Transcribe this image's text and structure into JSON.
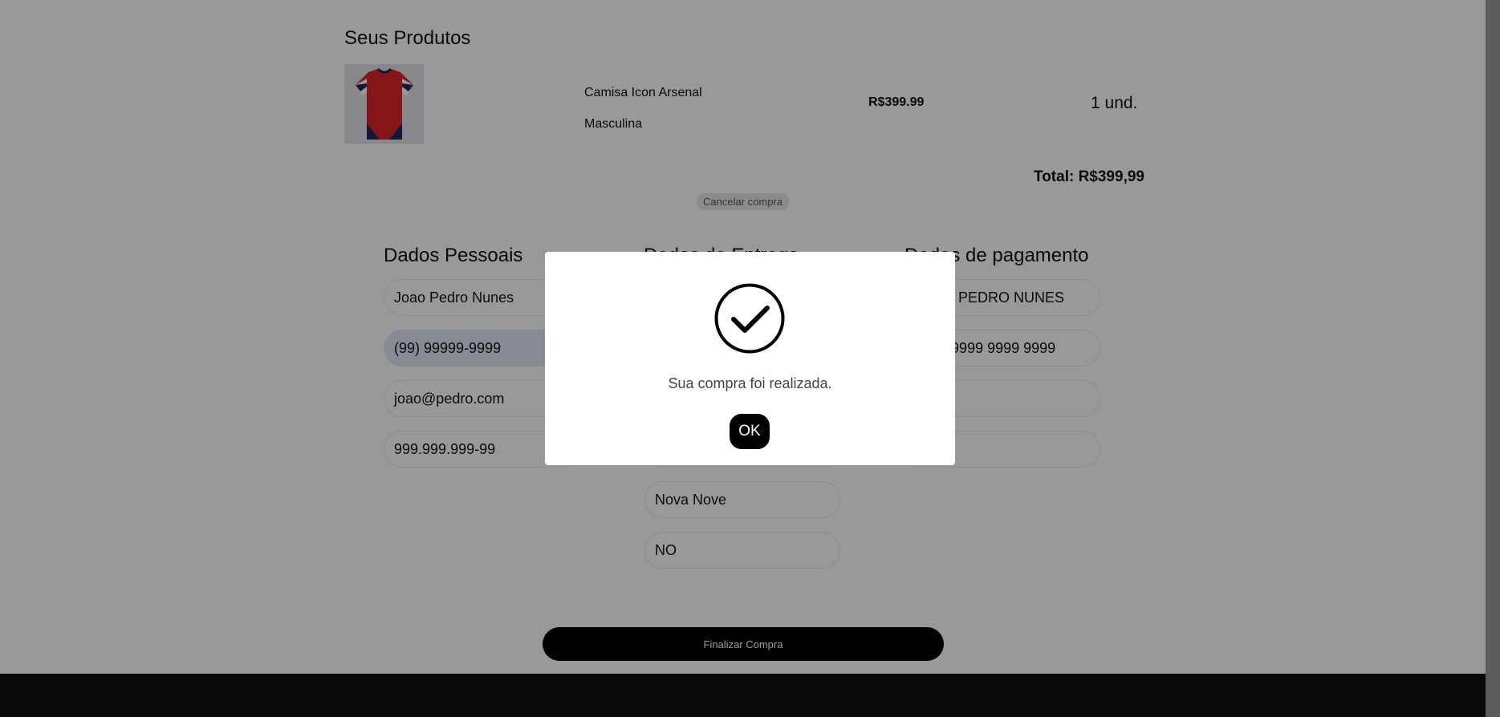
{
  "products": {
    "title": "Seus Produtos",
    "items": [
      {
        "name": "Camisa Icon Arsenal Masculina",
        "price": "R$399.99",
        "quantity": "1 und.",
        "image": "red-jersey-icon"
      }
    ],
    "total": "Total: R$399,99",
    "cancel_label": "Cancelar compra"
  },
  "personal": {
    "title": "Dados Pessoais",
    "name": "Joao Pedro Nunes",
    "phone": "(99) 99999-9999",
    "email": "joao@pedro.com",
    "cpf": "999.999.999-99"
  },
  "delivery": {
    "title": "Dados de Entrega",
    "field5": "Nova Nove",
    "field6": "NO"
  },
  "payment": {
    "title": "Dados de pagamento",
    "card_name": "JOAO PEDRO NUNES",
    "card_number": "9999 9999 9999 9999"
  },
  "submit_label": "Finalizar Compra",
  "modal": {
    "icon": "check-circle-icon",
    "message": "Sua compra foi realizada.",
    "ok_label": "OK"
  },
  "colors": {
    "accent": "#000000",
    "overlay": "rgba(0,0,0,0.4)",
    "field_focus": "#e2e8f5"
  }
}
